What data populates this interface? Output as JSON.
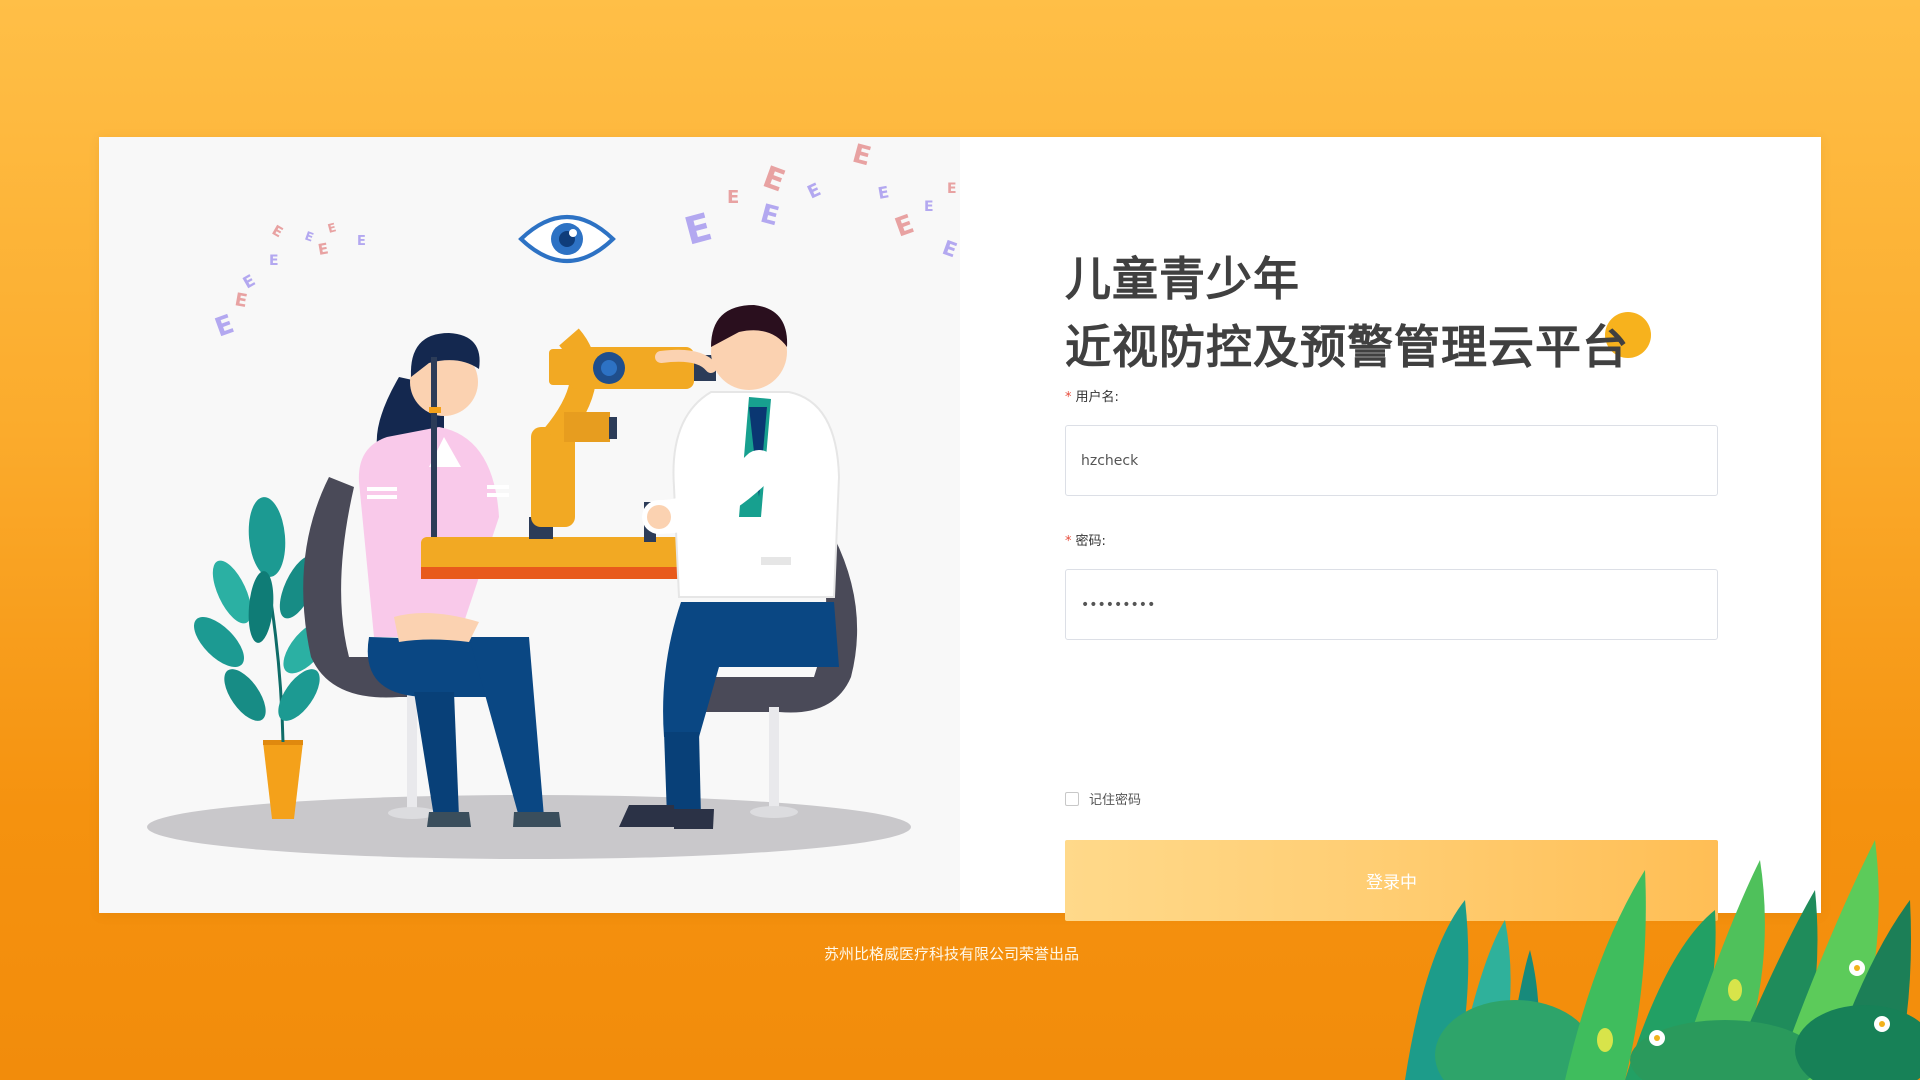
{
  "title": {
    "line1": "儿童青少年",
    "line2": "近视防控及预警管理云平台"
  },
  "form": {
    "username_label": "用户名:",
    "username_value": "hzcheck",
    "password_label": "密码:",
    "password_value": "password1",
    "remember_label": "记住密码",
    "remember_checked": false,
    "required_mark": "*",
    "login_button": "登录中"
  },
  "footer": {
    "text": "苏州比格威医疗科技有限公司荣誉出品"
  },
  "illustration": {
    "chart_letter": "E"
  },
  "colors": {
    "background_top": "#ffbf47",
    "background_bottom": "#f28c0b",
    "accent": "#f7b21d",
    "button": "#ffcd72",
    "title_text": "#404040"
  }
}
